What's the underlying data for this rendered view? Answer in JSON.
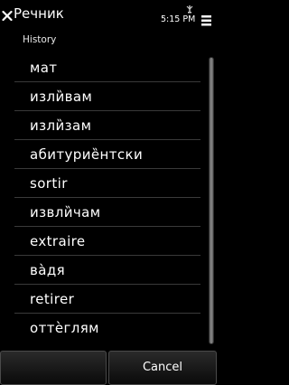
{
  "header": {
    "title": "Речник",
    "clock": "5:15 PM",
    "close_icon": "close-icon",
    "signal_icon": "signal-icon",
    "menu_icon": "options-menu-icon"
  },
  "section_label": "History",
  "history": [
    "мат",
    "изли̏вам",
    "изли̏зам",
    "абитурие̏нтски",
    "sortir",
    "извли̏чам",
    "extraire",
    "ва̀дя",
    "retirer",
    "оттѐглям"
  ],
  "softkeys": {
    "left_label": "",
    "right_label": "Cancel"
  }
}
